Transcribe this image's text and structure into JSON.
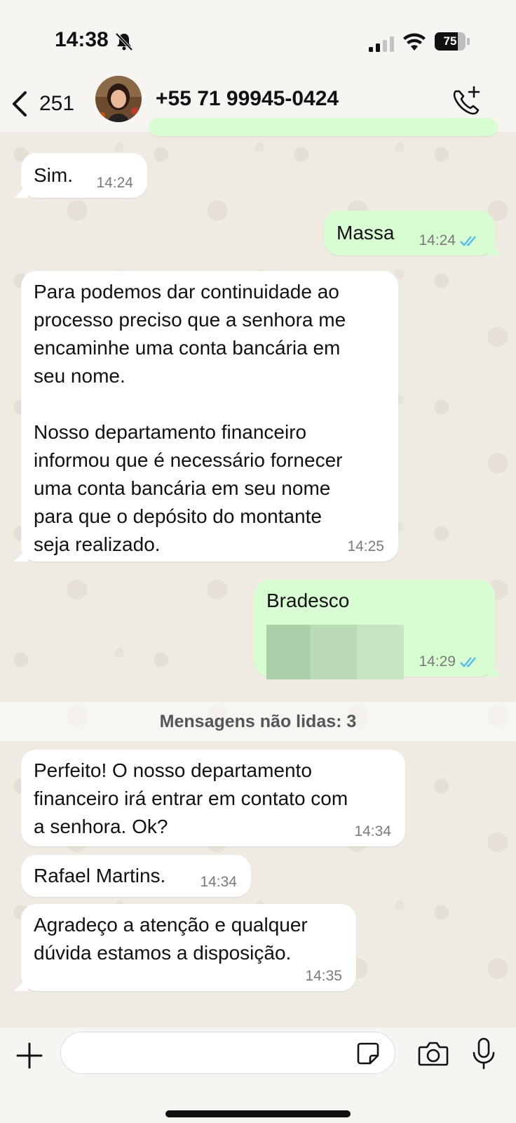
{
  "status_bar": {
    "time": "14:38",
    "battery_level": "75",
    "icons": [
      "bell-slash-icon",
      "cellular-signal-icon",
      "wifi-icon",
      "battery-icon"
    ]
  },
  "header": {
    "back_count": "251",
    "contact_name": "+55 71 99945-0424",
    "icons": [
      "chevron-left-icon",
      "add-call-icon"
    ]
  },
  "messages": [
    {
      "direction": "in",
      "text": "Sim.",
      "time": "14:24"
    },
    {
      "direction": "out",
      "text": "Massa",
      "time": "14:24",
      "status": "read"
    },
    {
      "direction": "in",
      "text": "Para podemos dar continuidade ao\nprocesso preciso que a senhora me\nencaminhe uma conta bancária em\nseu nome.\n\nNosso departamento financeiro\ninformou que é necessário fornecer\numa conta bancária em seu nome\npara que o depósito do montante\nseja realizado.",
      "time": "14:25"
    },
    {
      "direction": "out",
      "text": "Bradesco",
      "time": "14:29",
      "status": "read"
    },
    {
      "direction": "in",
      "text": "Perfeito! O nosso departamento\nfinanceiro irá entrar em contato com\na senhora. Ok?",
      "time": "14:34"
    },
    {
      "direction": "in",
      "text": "Rafael Martins.",
      "time": "14:34"
    },
    {
      "direction": "in",
      "text": "Agradeço a atenção e qualquer\ndúvida estamos a disposição.",
      "time": "14:35"
    }
  ],
  "unread_banner": "Mensagens não lidas: 3",
  "composer": {
    "icons": [
      "plus-icon",
      "sticker-icon",
      "camera-icon",
      "microphone-icon"
    ]
  },
  "colors": {
    "incoming_bubble": "#ffffff",
    "outgoing_bubble": "#d9fdd3",
    "read_ticks": "#53bdeb",
    "wallpaper": "#efeae2"
  }
}
